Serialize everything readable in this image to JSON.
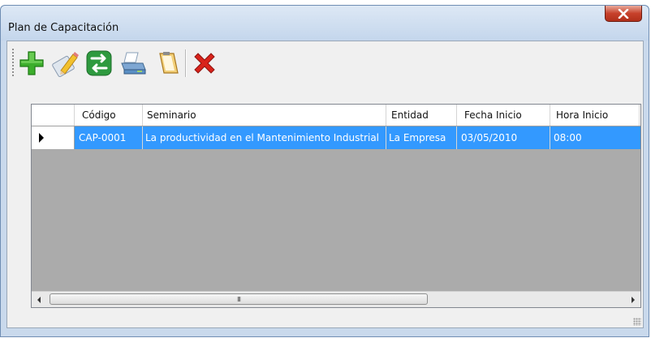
{
  "window": {
    "title": "Plan de Capacitación",
    "close_label": "X"
  },
  "toolbar": {
    "buttons": [
      {
        "name": "add",
        "icon": "plus-icon",
        "color": "#3cae2c"
      },
      {
        "name": "edit",
        "icon": "pencil-icon",
        "color": "#e8a824"
      },
      {
        "name": "transfer",
        "icon": "swap-arrows-icon",
        "color": "#2e9a3f"
      },
      {
        "name": "print",
        "icon": "printer-icon",
        "color": "#5a8fc5"
      },
      {
        "name": "report",
        "icon": "notepad-icon",
        "color": "#d69a2a"
      },
      {
        "name": "delete",
        "icon": "x-icon",
        "color": "#d9231b"
      }
    ]
  },
  "grid": {
    "columns": [
      "Código",
      "Seminario",
      "Entidad",
      "Fecha Inicio",
      "Hora Inicio"
    ],
    "rows": [
      {
        "codigo": "CAP-0001",
        "seminario": "La productividad en el Mantenimiento Industrial",
        "entidad": "La Empresa",
        "fecha_inicio": "03/05/2010",
        "hora_inicio": "08:00"
      }
    ],
    "selection_color": "#3399ff"
  },
  "scrollbar": {
    "thumb_label": "III"
  }
}
